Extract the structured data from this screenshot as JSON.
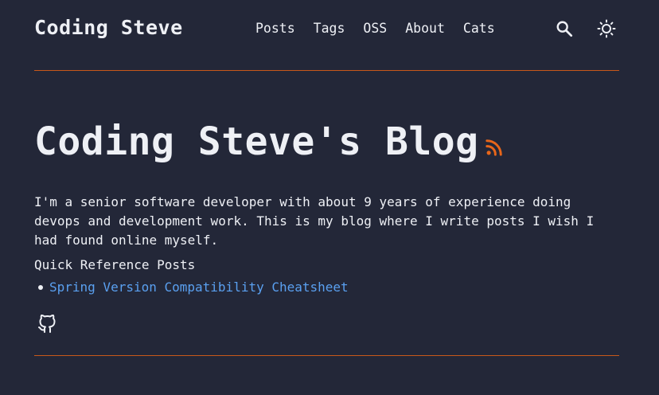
{
  "header": {
    "site_title": "Coding Steve",
    "nav": [
      {
        "label": "Posts"
      },
      {
        "label": "Tags"
      },
      {
        "label": "OSS"
      },
      {
        "label": "About"
      },
      {
        "label": "Cats"
      }
    ],
    "search_icon": "search-icon",
    "theme_icon": "sun-icon"
  },
  "hero": {
    "title": "Coding Steve's Blog",
    "rss_icon": "rss-icon"
  },
  "main": {
    "intro": "I'm a senior software developer with about 9 years of experience doing devops and development work. This is my blog where I write posts I wish I had found online myself.",
    "quick_reference": {
      "title": "Quick Reference Posts",
      "items": [
        {
          "label": "Spring Version Compatibility Cheatsheet"
        }
      ]
    },
    "social_icon": "github-icon"
  },
  "colors": {
    "background": "#232738",
    "text": "#eef0f5",
    "accent": "#c8581a",
    "link": "#5aa0f0"
  }
}
